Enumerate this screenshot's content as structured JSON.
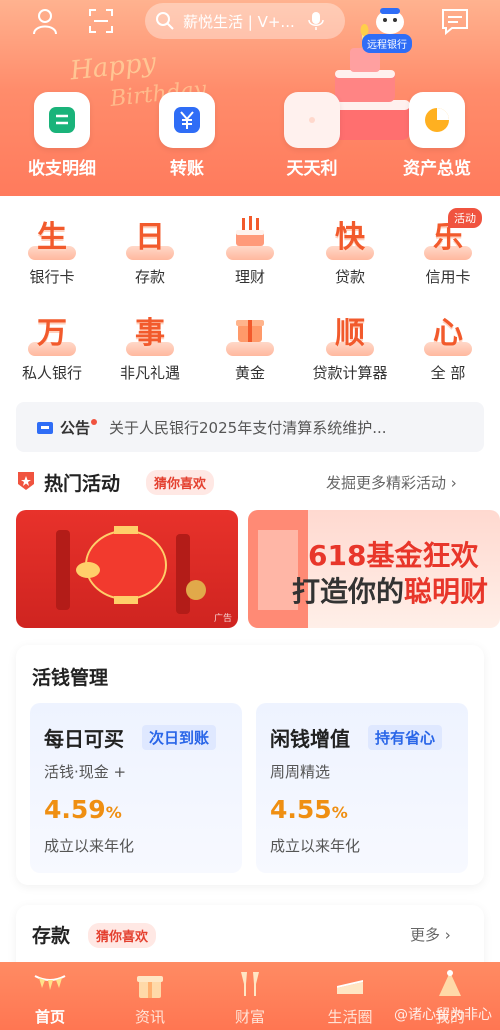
{
  "header": {
    "search_text": "薪悦生活 | V+...",
    "remote_badge": "远程银行",
    "birthday_1": "Happy",
    "birthday_2": "Birthday",
    "quick": [
      {
        "label": "收支明细",
        "icon": "ledger-icon"
      },
      {
        "label": "转账",
        "icon": "yuan-icon"
      },
      {
        "label": "天天利",
        "icon": "blank-tile-icon"
      },
      {
        "label": "资产总览",
        "icon": "pie-chart-icon"
      }
    ]
  },
  "grid": [
    {
      "char": "生",
      "label": "银行卡"
    },
    {
      "char": "日",
      "label": "存款"
    },
    {
      "char": "",
      "label": "理财"
    },
    {
      "char": "快",
      "label": "贷款"
    },
    {
      "char": "乐",
      "label": "信用卡"
    },
    {
      "char": "万",
      "label": "私人银行"
    },
    {
      "char": "事",
      "label": "非凡礼遇"
    },
    {
      "char": "",
      "label": "黄金"
    },
    {
      "char": "顺",
      "label": "贷款计算器"
    },
    {
      "char": "心",
      "label": "全 部"
    }
  ],
  "activity_badge": "活动",
  "notice": {
    "tag": "公告",
    "message": "关于人民银行2025年支付清算系统维护..."
  },
  "hot": {
    "title": "热门活动",
    "tag": "猜你喜欢",
    "more": "发掘更多精彩活动 ›"
  },
  "promo": {
    "ad_tag": "广告",
    "banner2_line1": "618基金狂欢",
    "banner2_line2a": "打造你的",
    "banner2_line2b": "聪明财"
  },
  "money": {
    "title": "活钱管理",
    "items": [
      {
        "name": "每日可买",
        "chip": "次日到账",
        "desc": "活钱·现金 +",
        "rate": "4.59",
        "unit": "%",
        "rate_label": "成立以来年化"
      },
      {
        "name": "闲钱增值",
        "chip": "持有省心",
        "desc": "周周精选",
        "rate": "4.55",
        "unit": "%",
        "rate_label": "成立以来年化"
      }
    ]
  },
  "deposit": {
    "title": "存款",
    "tag": "猜你喜欢",
    "more": "更多 ›"
  },
  "tabs": [
    {
      "label": "首页",
      "active": true
    },
    {
      "label": "资讯",
      "active": false
    },
    {
      "label": "财富",
      "active": false
    },
    {
      "label": "生活圈",
      "active": false
    },
    {
      "label": "我的",
      "active": false
    }
  ],
  "watermark": "@诸心留为非心",
  "colors": {
    "accent": "#f25a2c",
    "header": "#ff8c6b",
    "blue": "#2a66e8",
    "rate": "#ef8f12"
  }
}
